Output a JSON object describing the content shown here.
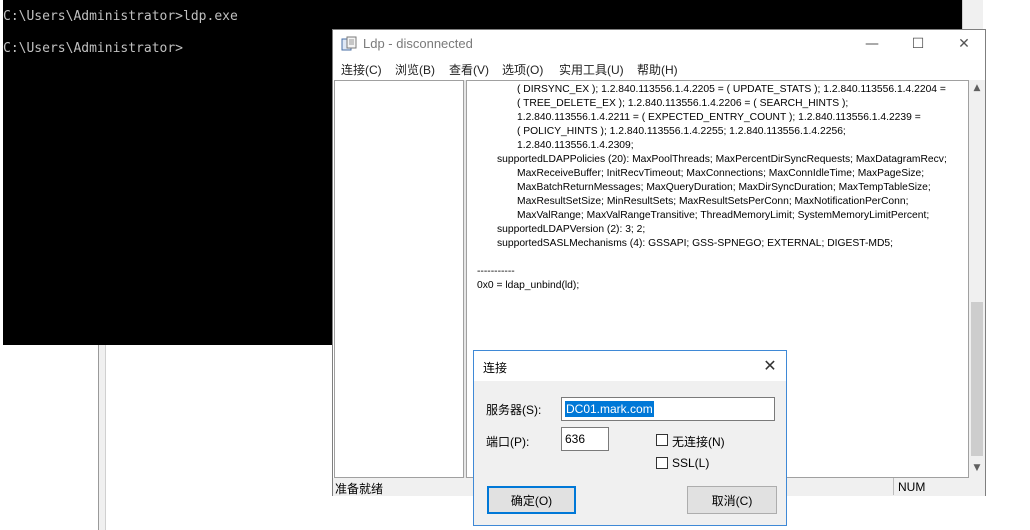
{
  "console": {
    "lines": [
      "C:\\Users\\Administrator>ldp.exe",
      "C:\\Users\\Administrator>"
    ]
  },
  "ldp": {
    "title": "Ldp - disconnected",
    "window_controls": {
      "minimize": "—",
      "maximize": "☐",
      "close": "✕"
    },
    "menu": [
      "连接(C)",
      "浏览(B)",
      "查看(V)",
      "选项(O)",
      "实用工具(U)",
      "帮助(H)"
    ],
    "output_lines": [
      {
        "indent": 2,
        "text": "( DIRSYNC_EX ); 1.2.840.113556.1.4.2205 = ( UPDATE_STATS ); 1.2.840.113556.1.4.2204 ="
      },
      {
        "indent": 2,
        "text": "( TREE_DELETE_EX ); 1.2.840.113556.1.4.2206 = ( SEARCH_HINTS );"
      },
      {
        "indent": 2,
        "text": "1.2.840.113556.1.4.2211 = ( EXPECTED_ENTRY_COUNT ); 1.2.840.113556.1.4.2239 ="
      },
      {
        "indent": 2,
        "text": "( POLICY_HINTS ); 1.2.840.113556.1.4.2255; 1.2.840.113556.1.4.2256;"
      },
      {
        "indent": 2,
        "text": "1.2.840.113556.1.4.2309;"
      },
      {
        "indent": 1,
        "text": "supportedLDAPPolicies (20): MaxPoolThreads; MaxPercentDirSyncRequests; MaxDatagramRecv;"
      },
      {
        "indent": 2,
        "text": "MaxReceiveBuffer; InitRecvTimeout; MaxConnections; MaxConnIdleTime; MaxPageSize;"
      },
      {
        "indent": 2,
        "text": "MaxBatchReturnMessages; MaxQueryDuration; MaxDirSyncDuration; MaxTempTableSize;"
      },
      {
        "indent": 2,
        "text": "MaxResultSetSize; MinResultSets; MaxResultSetsPerConn; MaxNotificationPerConn;"
      },
      {
        "indent": 2,
        "text": "MaxValRange; MaxValRangeTransitive; ThreadMemoryLimit; SystemMemoryLimitPercent;"
      },
      {
        "indent": 1,
        "text": "supportedLDAPVersion (2): 3; 2;"
      },
      {
        "indent": 1,
        "text": "supportedSASLMechanisms (4): GSSAPI; GSS-SPNEGO; EXTERNAL; DIGEST-MD5;"
      },
      {
        "indent": 0,
        "text": ""
      },
      {
        "indent": 0,
        "text": "-----------"
      },
      {
        "indent": 0,
        "text": "0x0 = ldap_unbind(ld);"
      }
    ],
    "scroll": {
      "up": "▲",
      "down": "▼"
    },
    "status_text": "准备就绪",
    "status_num": "NUM"
  },
  "dialog": {
    "title": "连接",
    "close": "✕",
    "server_label": "服务器(S):",
    "server_value": "DC01.mark.com",
    "port_label": "端口(P):",
    "port_value": "636",
    "connectionless_label": "无连接(N)",
    "connectionless_checked": false,
    "ssl_label": "SSL(L)",
    "ssl_checked": false,
    "ok_label": "确定(O)",
    "cancel_label": "取消(C)"
  }
}
